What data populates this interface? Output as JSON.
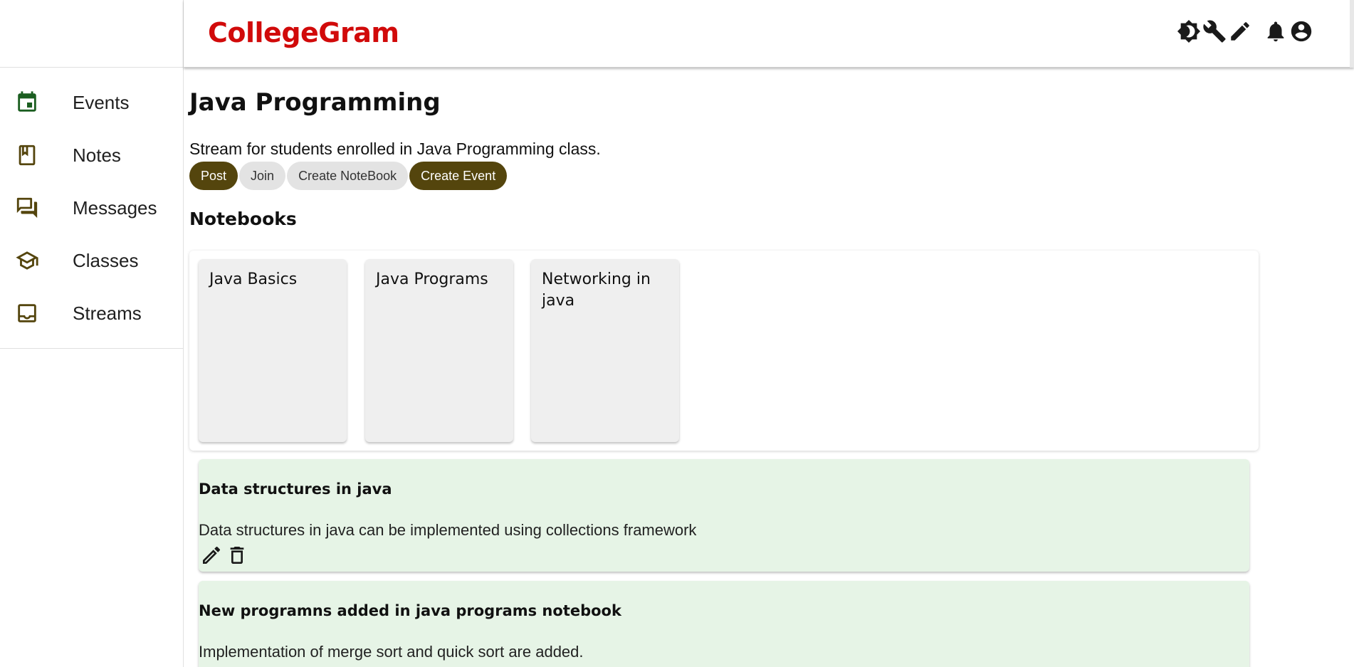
{
  "app": {
    "brand": "CollegeGram",
    "brand_color": "#d10a0a",
    "accent_color": "#54450d",
    "post_bg": "#e6f4e6"
  },
  "sidebar": {
    "items": [
      {
        "label": "Events",
        "icon": "calendar-icon"
      },
      {
        "label": "Notes",
        "icon": "bookmark-book-icon"
      },
      {
        "label": "Messages",
        "icon": "forum-icon"
      },
      {
        "label": "Classes",
        "icon": "school-icon"
      },
      {
        "label": "Streams",
        "icon": "inbox-icon"
      }
    ]
  },
  "header": {
    "icons": [
      "brightness-icon",
      "wrench-icon",
      "pencil-icon",
      "bell-icon",
      "account-icon"
    ]
  },
  "stream": {
    "title": "Java Programming",
    "description": "Stream for students enrolled in Java Programming class.",
    "actions": {
      "post": "Post",
      "join": "Join",
      "create_notebook": "Create NoteBook",
      "create_event": "Create Event"
    }
  },
  "notebooks": {
    "title": "Notebooks",
    "items": [
      "Java Basics",
      "Java Programs",
      "Networking in java"
    ]
  },
  "posts": [
    {
      "title": "Data structures in java",
      "body": "Data structures in java can be implemented using collections framework"
    },
    {
      "title": "New programns added in java programs notebook",
      "body": "Implementation of merge sort and quick sort are added."
    }
  ]
}
